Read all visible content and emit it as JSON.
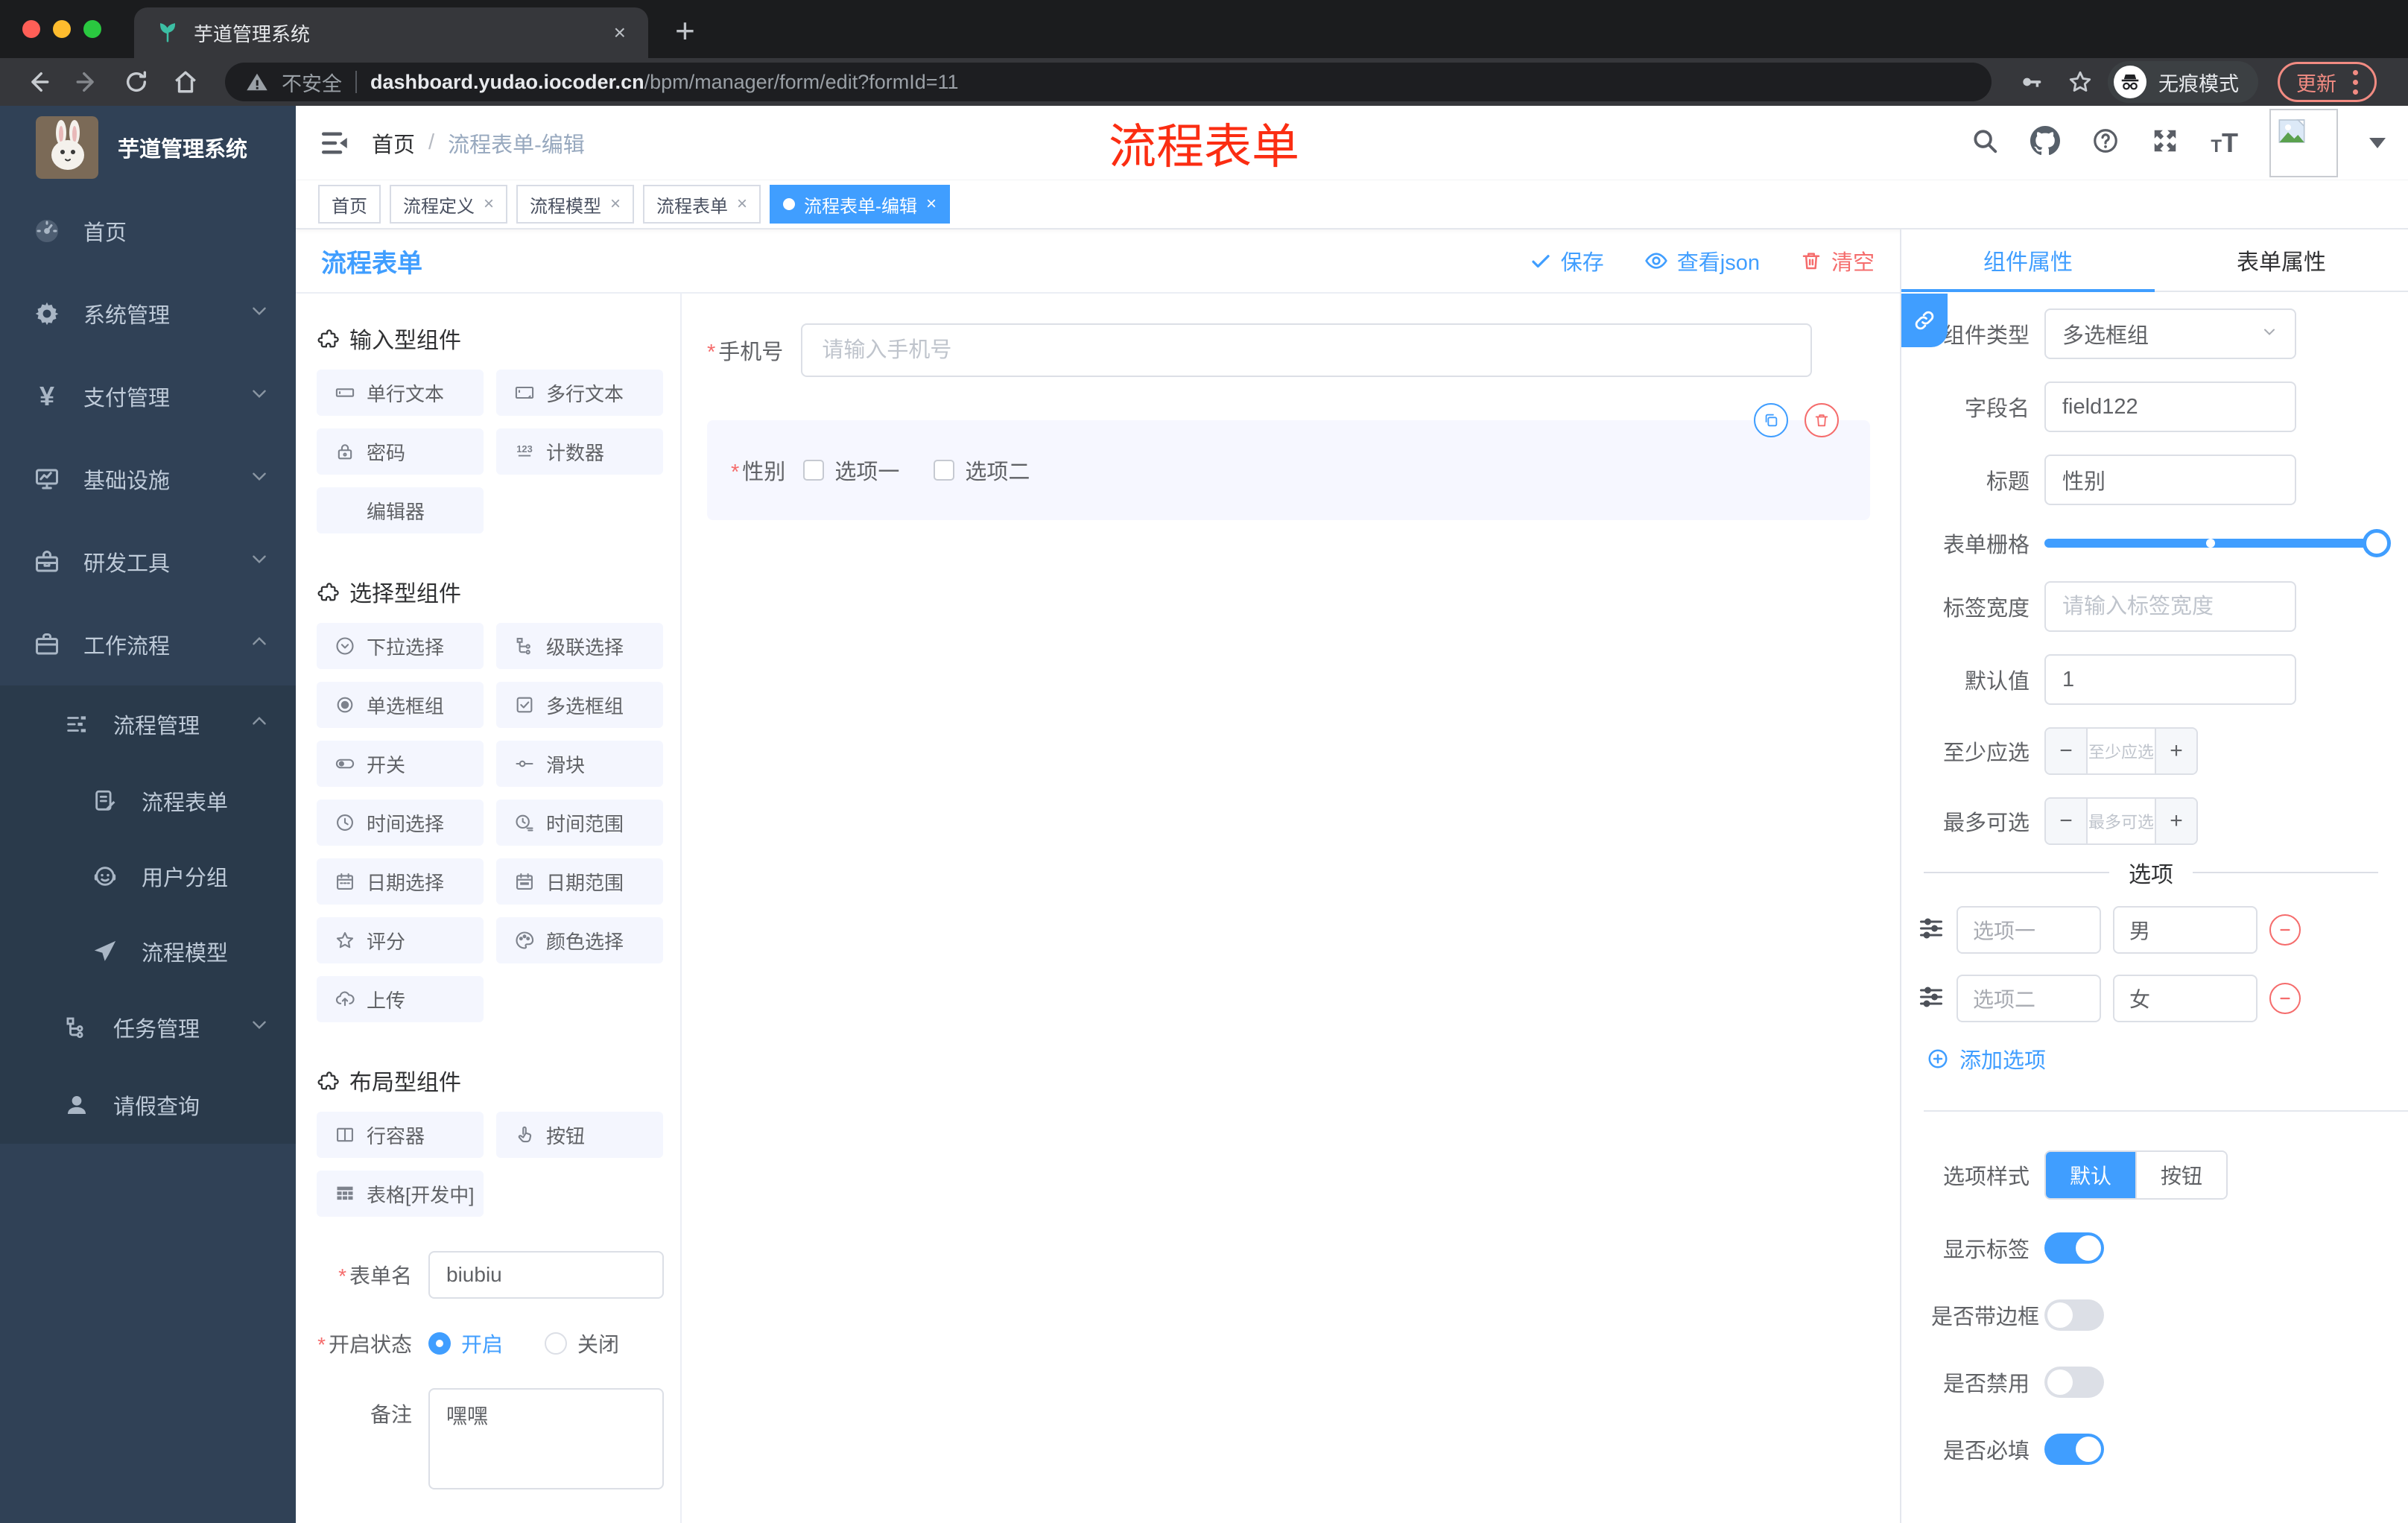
{
  "ui": {
    "close": "×",
    "plus": "+",
    "minus": "−",
    "slash": "/",
    "asterisk": "*"
  },
  "browser": {
    "tab_title": "芋道管理系统",
    "security_label": "不安全",
    "url_host": "dashboard.yudao.iocoder.cn",
    "url_path": "/bpm/manager/form/edit?formId=11",
    "incognito_label": "无痕模式",
    "update_label": "更新"
  },
  "sidebar": {
    "app_title": "芋道管理系统",
    "items": [
      {
        "label": "首页"
      },
      {
        "label": "系统管理"
      },
      {
        "label": "支付管理"
      },
      {
        "label": "基础设施"
      },
      {
        "label": "研发工具"
      },
      {
        "label": "工作流程"
      }
    ],
    "submenu": {
      "group": "流程管理",
      "children": [
        {
          "label": "流程表单"
        },
        {
          "label": "用户分组"
        },
        {
          "label": "流程模型"
        }
      ],
      "task_group": "任务管理",
      "leave_query": "请假查询"
    }
  },
  "navbar": {
    "breadcrumb_home": "首页",
    "breadcrumb_current": "流程表单-编辑",
    "annotation": "流程表单"
  },
  "tags": [
    {
      "label": "首页"
    },
    {
      "label": "流程定义"
    },
    {
      "label": "流程模型"
    },
    {
      "label": "流程表单"
    },
    {
      "label": "流程表单-编辑"
    }
  ],
  "designer": {
    "title": "流程表单",
    "save_label": "保存",
    "view_json_label": "查看json",
    "clear_label": "清空"
  },
  "components_panel": {
    "sections": [
      {
        "title": "输入型组件",
        "items": [
          "单行文本",
          "多行文本",
          "密码",
          "计数器",
          "编辑器"
        ]
      },
      {
        "title": "选择型组件",
        "items": [
          "下拉选择",
          "级联选择",
          "单选框组",
          "多选框组",
          "开关",
          "滑块",
          "时间选择",
          "时间范围",
          "日期选择",
          "日期范围",
          "评分",
          "颜色选择",
          "上传"
        ]
      },
      {
        "title": "布局型组件",
        "items": [
          "行容器",
          "按钮",
          "表格[开发中]"
        ]
      }
    ],
    "form": {
      "form_name_label": "表单名",
      "form_name_value": "biubiu",
      "status_label": "开启状态",
      "status_on": "开启",
      "status_off": "关闭",
      "remark_label": "备注",
      "remark_value": "嘿嘿"
    }
  },
  "canvas": {
    "phone_label": "手机号",
    "phone_placeholder": "请输入手机号",
    "gender_label": "性别",
    "gender_options": [
      "选项一",
      "选项二"
    ]
  },
  "inspector": {
    "tabs": [
      "组件属性",
      "表单属性"
    ],
    "component_type_label": "组件类型",
    "component_type_value": "多选框组",
    "field_name_label": "字段名",
    "field_name_value": "field122",
    "title_label": "标题",
    "title_value": "性别",
    "grid_label": "表单栅格",
    "label_width_label": "标签宽度",
    "label_width_placeholder": "请输入标签宽度",
    "default_label": "默认值",
    "default_value": "1",
    "min_label": "至少应选",
    "min_placeholder": "至少应选",
    "max_label": "最多可选",
    "max_placeholder": "最多可选",
    "options_divider": "选项",
    "options": [
      {
        "label": "选项一",
        "value": "男"
      },
      {
        "label": "选项二",
        "value": "女"
      }
    ],
    "add_option_label": "添加选项",
    "style_label": "选项样式",
    "style_default": "默认",
    "style_button": "按钮",
    "toggles": [
      {
        "label": "显示标签"
      },
      {
        "label": "是否带边框"
      },
      {
        "label": "是否禁用"
      },
      {
        "label": "是否必填"
      }
    ]
  }
}
